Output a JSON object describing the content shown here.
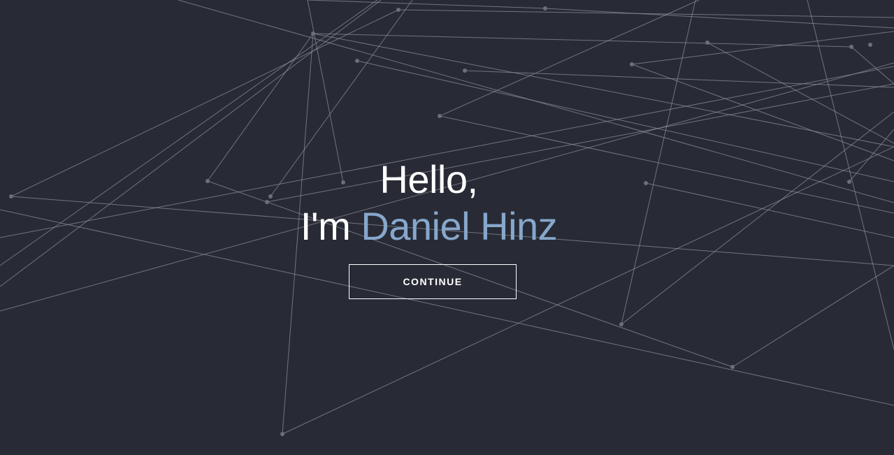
{
  "hero": {
    "greeting_line1": "Hello,",
    "greeting_prefix": "I'm ",
    "name": "Daniel Hinz",
    "cta_label": "CONTINUE"
  },
  "colors": {
    "background": "#282b35",
    "text": "#ffffff",
    "name_accent": "#87a7cc",
    "network_line": "#8a8d96",
    "network_node": "#6c6f78"
  }
}
